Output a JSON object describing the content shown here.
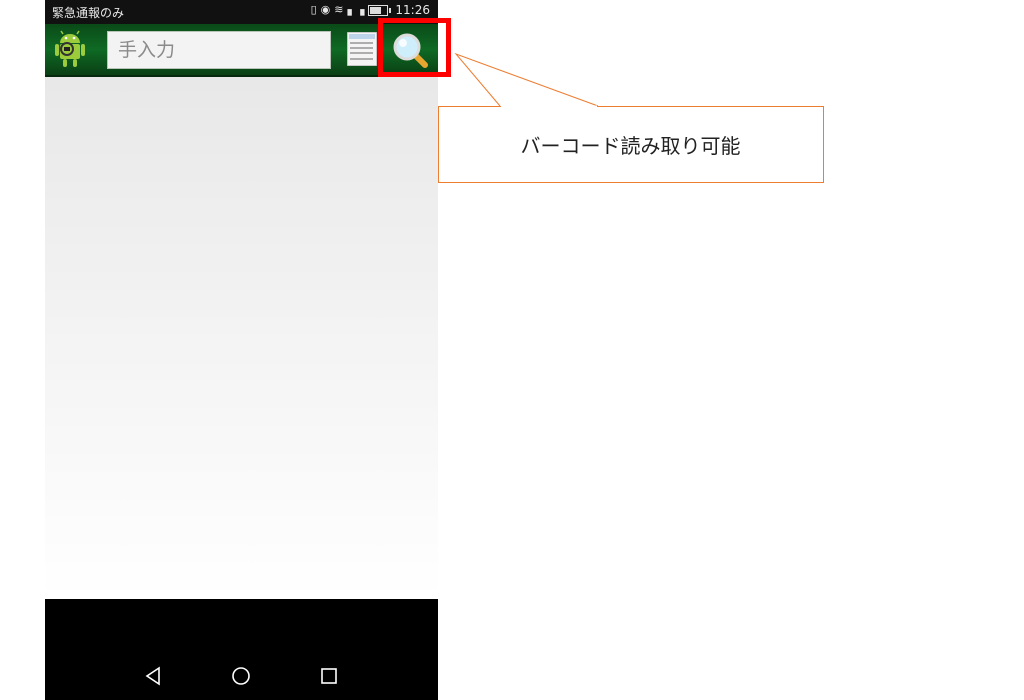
{
  "status_bar": {
    "carrier": "緊急通報のみ",
    "time": "11:26"
  },
  "toolbar": {
    "search_placeholder": "手入力",
    "doc_icon": "document-list-icon",
    "search_icon": "magnifier-icon",
    "app_icon": "android-barcode-icon"
  },
  "callout": {
    "text": "バーコード読み取り可能"
  },
  "colors": {
    "toolbar_green": "#0f6a24",
    "highlight_red": "#ff0000",
    "callout_orange": "#ed7d31"
  }
}
